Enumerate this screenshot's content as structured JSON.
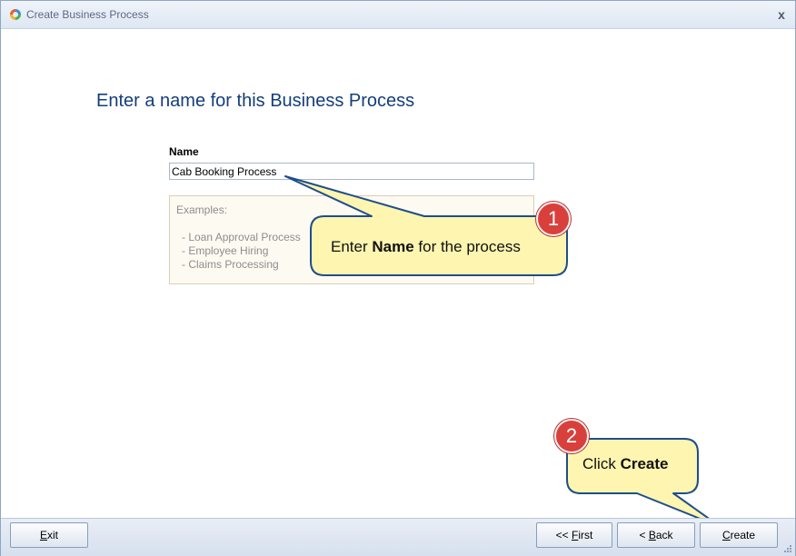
{
  "window": {
    "title": "Create Business Process",
    "close_glyph": "x"
  },
  "main": {
    "heading": "Enter a name for this Business Process",
    "name_label": "Name",
    "name_value": "Cab Booking Process",
    "examples_title": "Examples:",
    "examples": [
      "- Loan Approval Process",
      "- Employee Hiring",
      "- Claims Processing"
    ]
  },
  "callouts": [
    {
      "number": "1",
      "prefix": "Enter ",
      "bold": "Name",
      "suffix": " for the process"
    },
    {
      "number": "2",
      "prefix": "Click ",
      "bold": "Create",
      "suffix": ""
    }
  ],
  "footer": {
    "exit": {
      "mnemonic": "E",
      "rest": "xit"
    },
    "first": {
      "before": "<< ",
      "mnemonic": "F",
      "rest": "irst"
    },
    "back": {
      "before": "< ",
      "mnemonic": "B",
      "rest": "ack"
    },
    "create": {
      "mnemonic": "C",
      "rest": "reate"
    }
  },
  "colors": {
    "heading": "#153d7a",
    "callout_fill": "#fdf5b0",
    "callout_border": "#1f4e8a",
    "badge": "#d9403c"
  }
}
